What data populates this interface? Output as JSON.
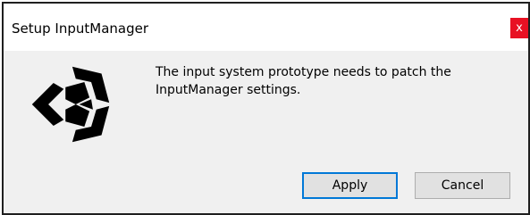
{
  "window": {
    "title": "Setup InputManager",
    "close_glyph": "x"
  },
  "icon": {
    "name": "unity-logo-icon"
  },
  "message": {
    "line1": "The input system prototype needs to patch the",
    "line2": "InputManager settings."
  },
  "buttons": {
    "apply_label": "Apply",
    "cancel_label": "Cancel"
  },
  "colors": {
    "close_button": "#e81123",
    "default_button_border": "#0078d7",
    "dialog_background": "#f0f0f0"
  }
}
